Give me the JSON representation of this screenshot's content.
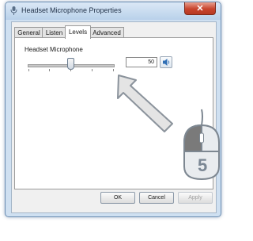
{
  "window": {
    "title": "Headset Microphone Properties",
    "close_glyph": "✕"
  },
  "tabs": [
    {
      "label": "General",
      "active": false
    },
    {
      "label": "Listen",
      "active": false
    },
    {
      "label": "Levels",
      "active": true
    },
    {
      "label": "Advanced",
      "active": false
    }
  ],
  "levels": {
    "group_label": "Headset Microphone",
    "value": "50",
    "slider_fraction": 0.5
  },
  "buttons": {
    "ok": "OK",
    "cancel": "Cancel",
    "apply": "Apply"
  },
  "annotation": {
    "step_number": "5",
    "colors": {
      "arrow_fill": "#e4e4e4",
      "arrow_stroke": "#8b939c",
      "mouse_highlight": "#7a7a7a"
    }
  },
  "icons": {
    "title": "microphone-icon",
    "speaker": "speaker-icon",
    "pointer": "arrow-pointer-icon",
    "mouse": "mouse-left-click-icon"
  }
}
